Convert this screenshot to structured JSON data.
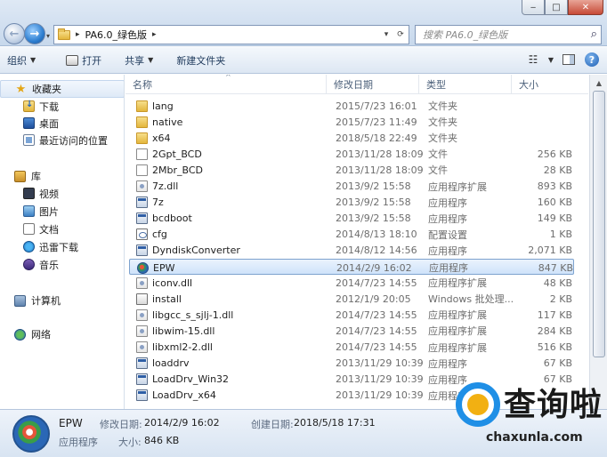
{
  "window": {
    "min": "‒",
    "max": "□",
    "close": "✕"
  },
  "address": {
    "path": "PA6.0_绿色版",
    "separator": "▸",
    "search_placeholder": "搜索 PA6.0_绿色版"
  },
  "toolbar": {
    "organize": "组织",
    "open": "打开",
    "share": "共享",
    "new_folder": "新建文件夹"
  },
  "sidebar": {
    "favorites": "收藏夹",
    "favorites_items": [
      "下载",
      "桌面",
      "最近访问的位置"
    ],
    "libraries": "库",
    "library_items": [
      "视频",
      "图片",
      "文档",
      "迅雷下载",
      "音乐"
    ],
    "computer": "计算机",
    "network": "网络"
  },
  "columns": {
    "name": "名称",
    "date": "修改日期",
    "type": "类型",
    "size": "大小"
  },
  "files": [
    {
      "name": "lang",
      "date": "2015/7/23 16:01",
      "type": "文件夹",
      "size": "",
      "icon": "folder"
    },
    {
      "name": "native",
      "date": "2015/7/23 11:49",
      "type": "文件夹",
      "size": "",
      "icon": "folder"
    },
    {
      "name": "x64",
      "date": "2018/5/18 22:49",
      "type": "文件夹",
      "size": "",
      "icon": "folder"
    },
    {
      "name": "2Gpt_BCD",
      "date": "2013/11/28 18:09",
      "type": "文件",
      "size": "256 KB",
      "icon": "file"
    },
    {
      "name": "2Mbr_BCD",
      "date": "2013/11/28 18:09",
      "type": "文件",
      "size": "28 KB",
      "icon": "file"
    },
    {
      "name": "7z.dll",
      "date": "2013/9/2 15:58",
      "type": "应用程序扩展",
      "size": "893 KB",
      "icon": "dll"
    },
    {
      "name": "7z",
      "date": "2013/9/2 15:58",
      "type": "应用程序",
      "size": "160 KB",
      "icon": "exe"
    },
    {
      "name": "bcdboot",
      "date": "2013/9/2 15:58",
      "type": "应用程序",
      "size": "149 KB",
      "icon": "exe"
    },
    {
      "name": "cfg",
      "date": "2014/8/13 18:10",
      "type": "配置设置",
      "size": "1 KB",
      "icon": "cfg"
    },
    {
      "name": "DyndiskConverter",
      "date": "2014/8/12 14:56",
      "type": "应用程序",
      "size": "2,071 KB",
      "icon": "exe"
    },
    {
      "name": "EPW",
      "date": "2014/2/9 16:02",
      "type": "应用程序",
      "size": "847 KB",
      "icon": "epw"
    },
    {
      "name": "iconv.dll",
      "date": "2014/7/23 14:55",
      "type": "应用程序扩展",
      "size": "48 KB",
      "icon": "dll"
    },
    {
      "name": "install",
      "date": "2012/1/9 20:05",
      "type": "Windows 批处理...",
      "size": "2 KB",
      "icon": "inst"
    },
    {
      "name": "libgcc_s_sjlj-1.dll",
      "date": "2014/7/23 14:55",
      "type": "应用程序扩展",
      "size": "117 KB",
      "icon": "dll"
    },
    {
      "name": "libwim-15.dll",
      "date": "2014/7/23 14:55",
      "type": "应用程序扩展",
      "size": "284 KB",
      "icon": "dll"
    },
    {
      "name": "libxml2-2.dll",
      "date": "2014/7/23 14:55",
      "type": "应用程序扩展",
      "size": "516 KB",
      "icon": "dll"
    },
    {
      "name": "loaddrv",
      "date": "2013/11/29 10:39",
      "type": "应用程序",
      "size": "67 KB",
      "icon": "exe"
    },
    {
      "name": "LoadDrv_Win32",
      "date": "2013/11/29 10:39",
      "type": "应用程序",
      "size": "67 KB",
      "icon": "exe"
    },
    {
      "name": "LoadDrv_x64",
      "date": "2013/11/29 10:39",
      "type": "应用程序",
      "size": "",
      "icon": "exe"
    }
  ],
  "selected_index": 10,
  "details": {
    "name": "EPW",
    "type": "应用程序",
    "modified_label": "修改日期:",
    "modified_value": "2014/2/9 16:02",
    "created_label": "创建日期:",
    "created_value": "2018/5/18 17:31",
    "size_label": "大小:",
    "size_value": "846 KB"
  },
  "watermark": {
    "title": "查询啦",
    "url": "chaxunla.com"
  },
  "colors": {
    "selection": "#cfe3fa",
    "accent": "#1f8fe6",
    "watermark_dot": "#f2b012"
  }
}
